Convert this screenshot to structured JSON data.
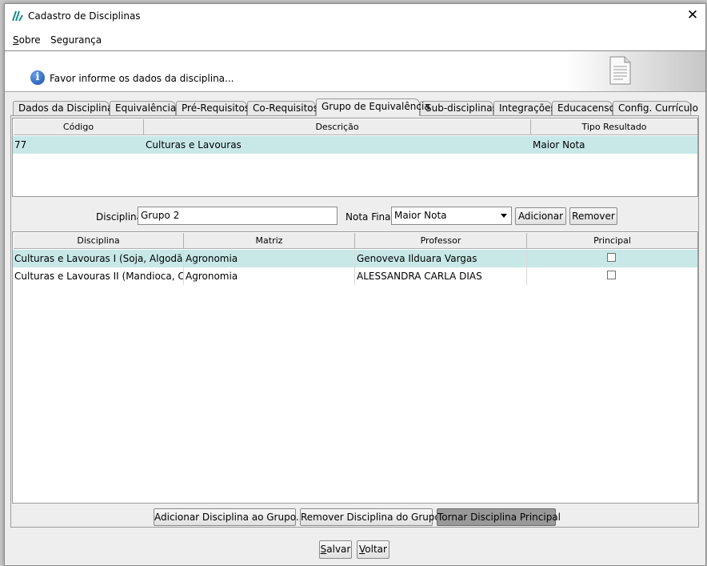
{
  "window": {
    "title": "Cadastro de Disciplinas",
    "close": "✕"
  },
  "menu": {
    "sobre": {
      "u": "S",
      "rest": "obre"
    },
    "seguranca": "Segurança"
  },
  "info": {
    "text": "Favor informe os dados da disciplina...",
    "icon": "i"
  },
  "tabs": [
    "Dados da Disciplina",
    "Equivalências",
    "Pré-Requisitos",
    "Co-Requisitos",
    "Grupo de Equivalência",
    "Sub-disciplinas",
    "Integrações",
    "Educacenso",
    "Config. Currículo"
  ],
  "groups_table": {
    "headers": [
      "Código",
      "Descrição",
      "Tipo Resultado"
    ],
    "rows": [
      [
        "77",
        "Culturas e Lavouras",
        "Maior Nota"
      ]
    ]
  },
  "form": {
    "disciplina_label": "Disciplina",
    "disciplina_value": "Grupo 2",
    "nota_final_label": "Nota Final:",
    "nota_final_value": "Maior Nota",
    "adicionar": "Adicionar",
    "remover": "Remover"
  },
  "disciplinas_table": {
    "headers": [
      "Disciplina",
      "Matriz",
      "Professor",
      "Principal"
    ],
    "rows": [
      [
        "Culturas e Lavouras I (Soja, Algodão e ...",
        "Agronomia",
        "Genoveva Ilduara Vargas",
        false
      ],
      [
        "Culturas e Lavouras II (Mandioca, Café...",
        "Agronomia",
        "ALESSANDRA CARLA DIAS",
        false
      ]
    ]
  },
  "actions": {
    "add_to_group": "Adicionar Disciplina ao Grupo...",
    "remove_from_group": "Remover Disciplina do Grupo",
    "make_principal": "Tornar Disciplina Principal"
  },
  "footer": {
    "salvar": {
      "u": "S",
      "rest": "alvar"
    },
    "voltar": {
      "u": "V",
      "rest": "oltar"
    }
  }
}
